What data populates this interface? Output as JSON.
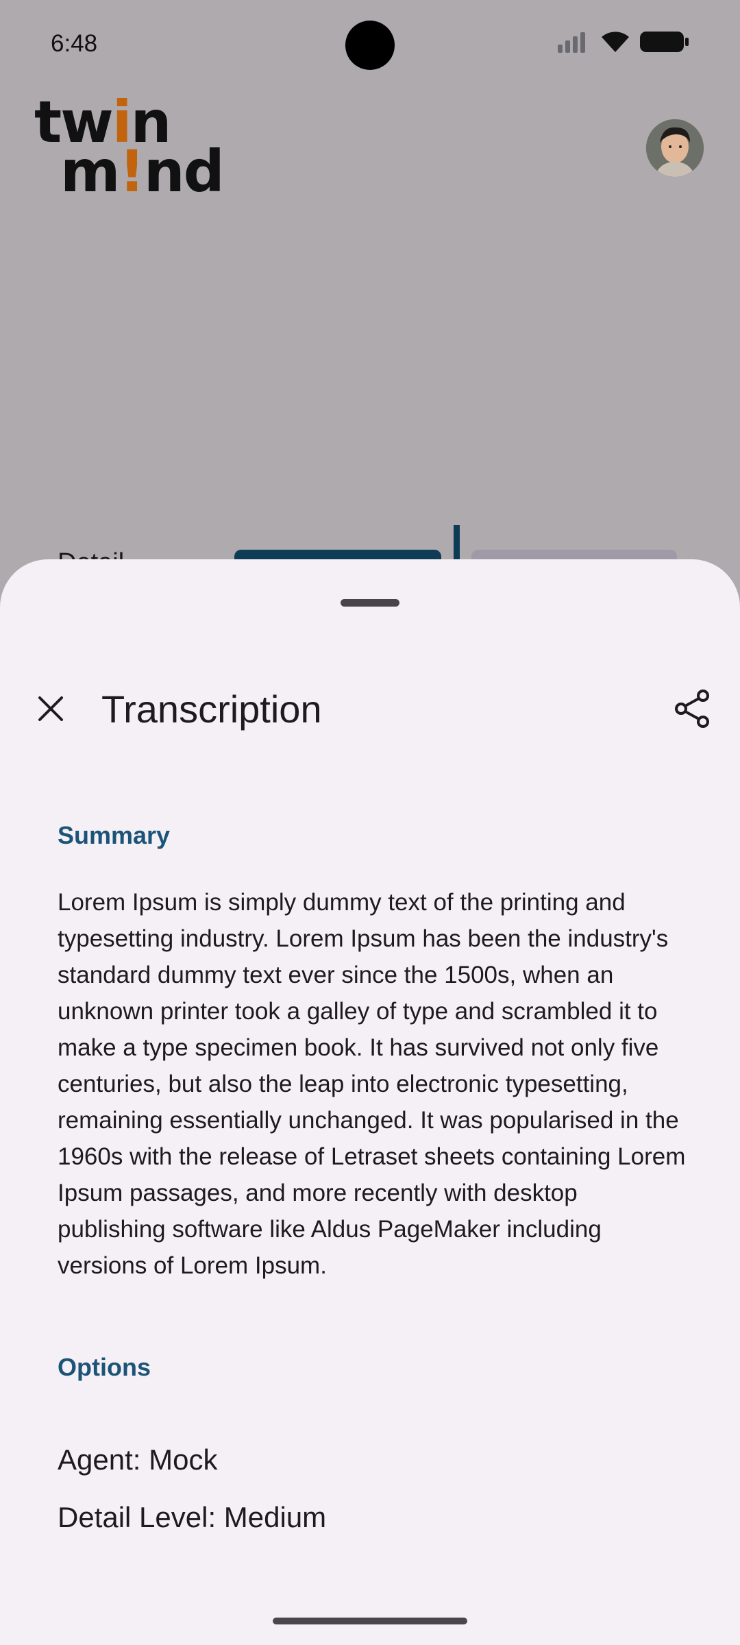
{
  "status_bar": {
    "time": "6:48",
    "icons": [
      "signal-icon",
      "wifi-icon",
      "battery-icon"
    ]
  },
  "app": {
    "logo_line1": "tw",
    "logo_i": "i",
    "logo_line1_end": "n",
    "logo_line2_start": "m",
    "logo_line2_end": "nd",
    "logo_accent_color": "#c2630d",
    "background_peek_label": "Detail"
  },
  "sheet": {
    "title": "Transcription",
    "summary_label": "Summary",
    "summary_text": "Lorem Ipsum is simply dummy text of the printing and typesetting industry. Lorem Ipsum has been the industry's standard dummy text ever since the 1500s, when an unknown printer took a galley of type and scrambled it to make a type specimen book. It has survived not only five centuries, but also the leap into electronic typesetting, remaining essentially unchanged. It was popularised in the 1960s with the release of Letraset sheets containing Lorem Ipsum passages, and more recently with desktop publishing software like Aldus PageMaker including versions of Lorem Ipsum.",
    "options_label": "Options",
    "options": {
      "agent": "Agent: Mock",
      "detail_level": "Detail Level: Medium"
    },
    "accent_color": "#1c5478"
  }
}
